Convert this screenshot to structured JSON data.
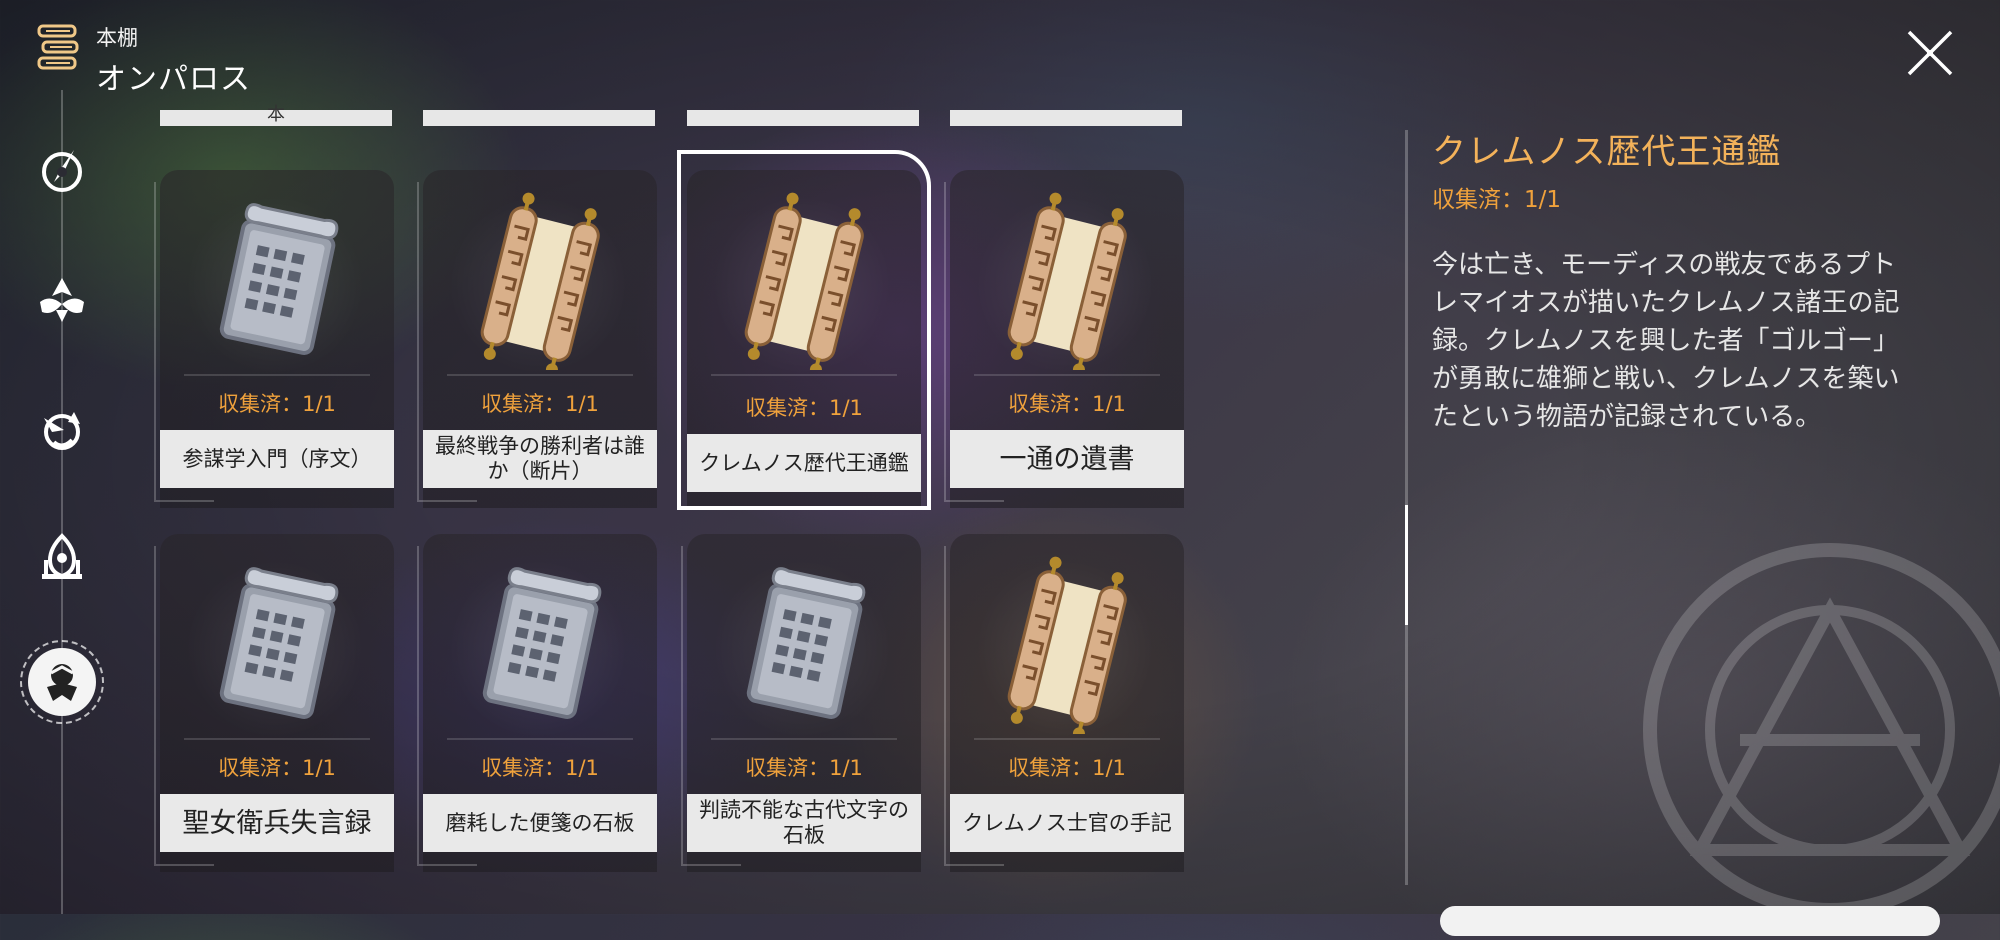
{
  "header": {
    "subtitle": "本棚",
    "title": "オンパロス"
  },
  "top_partial_labels": [
    "本",
    "",
    "",
    ""
  ],
  "cards": [
    {
      "status": "収集済：1/1",
      "label": "参謀学入門（序文）",
      "icon": "stone-tablet",
      "selected": false
    },
    {
      "status": "収集済：1/1",
      "label": "最終戦争の勝利者は誰か（断片）",
      "icon": "scroll",
      "selected": false
    },
    {
      "status": "収集済：1/1",
      "label": "クレムノス歴代王通鑑",
      "icon": "scroll",
      "selected": true
    },
    {
      "status": "収集済：1/1",
      "label": "一通の遺書",
      "icon": "scroll",
      "selected": false
    },
    {
      "status": "収集済：1/1",
      "label": "聖女衛兵失言録",
      "icon": "stone-tablet",
      "selected": false
    },
    {
      "status": "収集済：1/1",
      "label": "磨耗した便箋の石板",
      "icon": "stone-tablet",
      "selected": false
    },
    {
      "status": "収集済：1/1",
      "label": "判読不能な古代文字の石板",
      "icon": "stone-tablet",
      "selected": false
    },
    {
      "status": "収集済：1/1",
      "label": "クレムノス士官の手記",
      "icon": "scroll",
      "selected": false
    }
  ],
  "detail": {
    "title": "クレムノス歴代王通鑑",
    "status": "収集済：1/1",
    "description": "今は亡き、モーディスの戦友であるプトレマイオスが描いたクレムノス諸王の記録。クレムノスを興した者「ゴルゴー」が勇敢に雄獅と戦い、クレムノスを築いたという物語が記録されている。"
  },
  "nav_icons": [
    "compass-icon",
    "tri-leaf-icon",
    "lion-icon",
    "temple-icon",
    "warrior-icon"
  ],
  "colors": {
    "accent": "#f0a23c",
    "title_gold": "#f3b25a",
    "label_bg": "#e9e9e9"
  }
}
